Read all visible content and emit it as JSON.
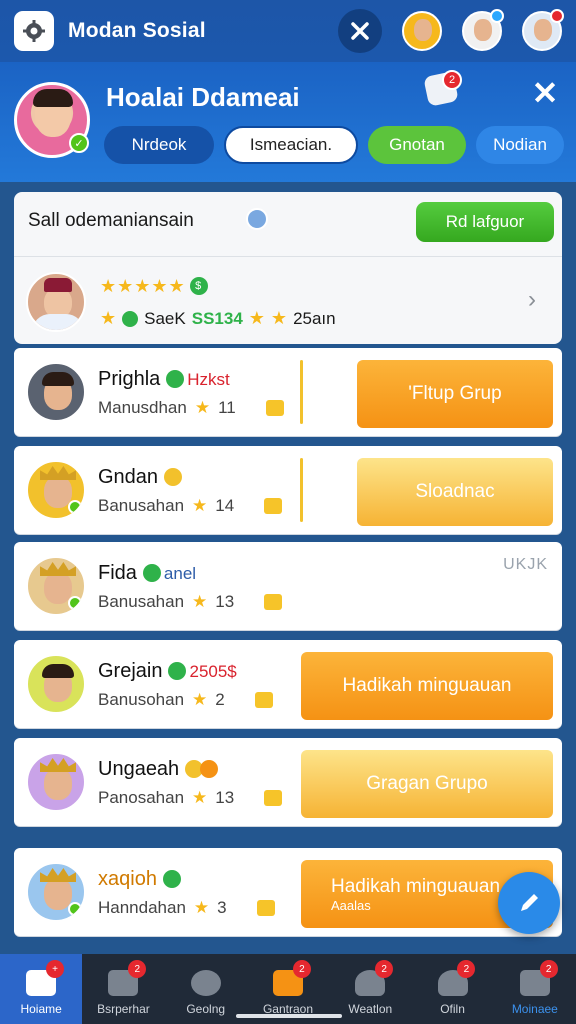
{
  "topbar": {
    "app_title": "Modan Sosial",
    "icons": [
      "settings-icon",
      "close-icon"
    ]
  },
  "profile": {
    "name": "Hoalai Ddameai",
    "notification_count": "2",
    "tabs": [
      {
        "label": "Nrdeok"
      },
      {
        "label": "Ismeacian."
      },
      {
        "label": "Gnotan"
      },
      {
        "label": "Nodian"
      }
    ]
  },
  "panel": {
    "title": "Sall  odemaniansain",
    "action_label": "Rd lafguor",
    "stats_a": "SaeK",
    "stats_b": "SS134",
    "stats_c": "25aın"
  },
  "rows": [
    {
      "name": "Prighla",
      "tag": "Hzkst",
      "sub": "Manusdhan",
      "count": "11",
      "button": "'Fltup Grup",
      "note": ""
    },
    {
      "name": "Gndan",
      "tag": "",
      "sub": "Banusahan",
      "count": "14",
      "button": "Sloadnac",
      "note": ""
    },
    {
      "name": "Fida",
      "tag": "anel",
      "sub": "Banusahan",
      "count": "13",
      "button": "",
      "note": "UKJK"
    },
    {
      "name": "Grejain",
      "tag": "2505$",
      "sub": "Banusohan",
      "count": "2",
      "button": "Hadikah minguauan",
      "note": ""
    },
    {
      "name": "Ungaeah",
      "tag": "",
      "sub": "Panosahan",
      "count": "13",
      "button": "Gragan Grupo",
      "note": ""
    },
    {
      "name": "xaqioh",
      "tag": "",
      "sub": "Hanndahan",
      "count": "3",
      "button": "Hadikah minguauan",
      "button_sub": "Aaalas",
      "note": ""
    }
  ],
  "bottom_nav": [
    {
      "label": "Hoiame",
      "badge": "+"
    },
    {
      "label": "Bsrperhar",
      "badge": "2"
    },
    {
      "label": "Geolng",
      "badge": ""
    },
    {
      "label": "Gantraon",
      "badge": "2"
    },
    {
      "label": "Weatlon",
      "badge": "2"
    },
    {
      "label": "Ofiln",
      "badge": "2"
    },
    {
      "label": "Moinaee",
      "badge": "2"
    }
  ],
  "colors": {
    "accent": "#1d56a8",
    "orange": "#f59214",
    "green": "#52c41a",
    "badge": "#e5282f"
  }
}
